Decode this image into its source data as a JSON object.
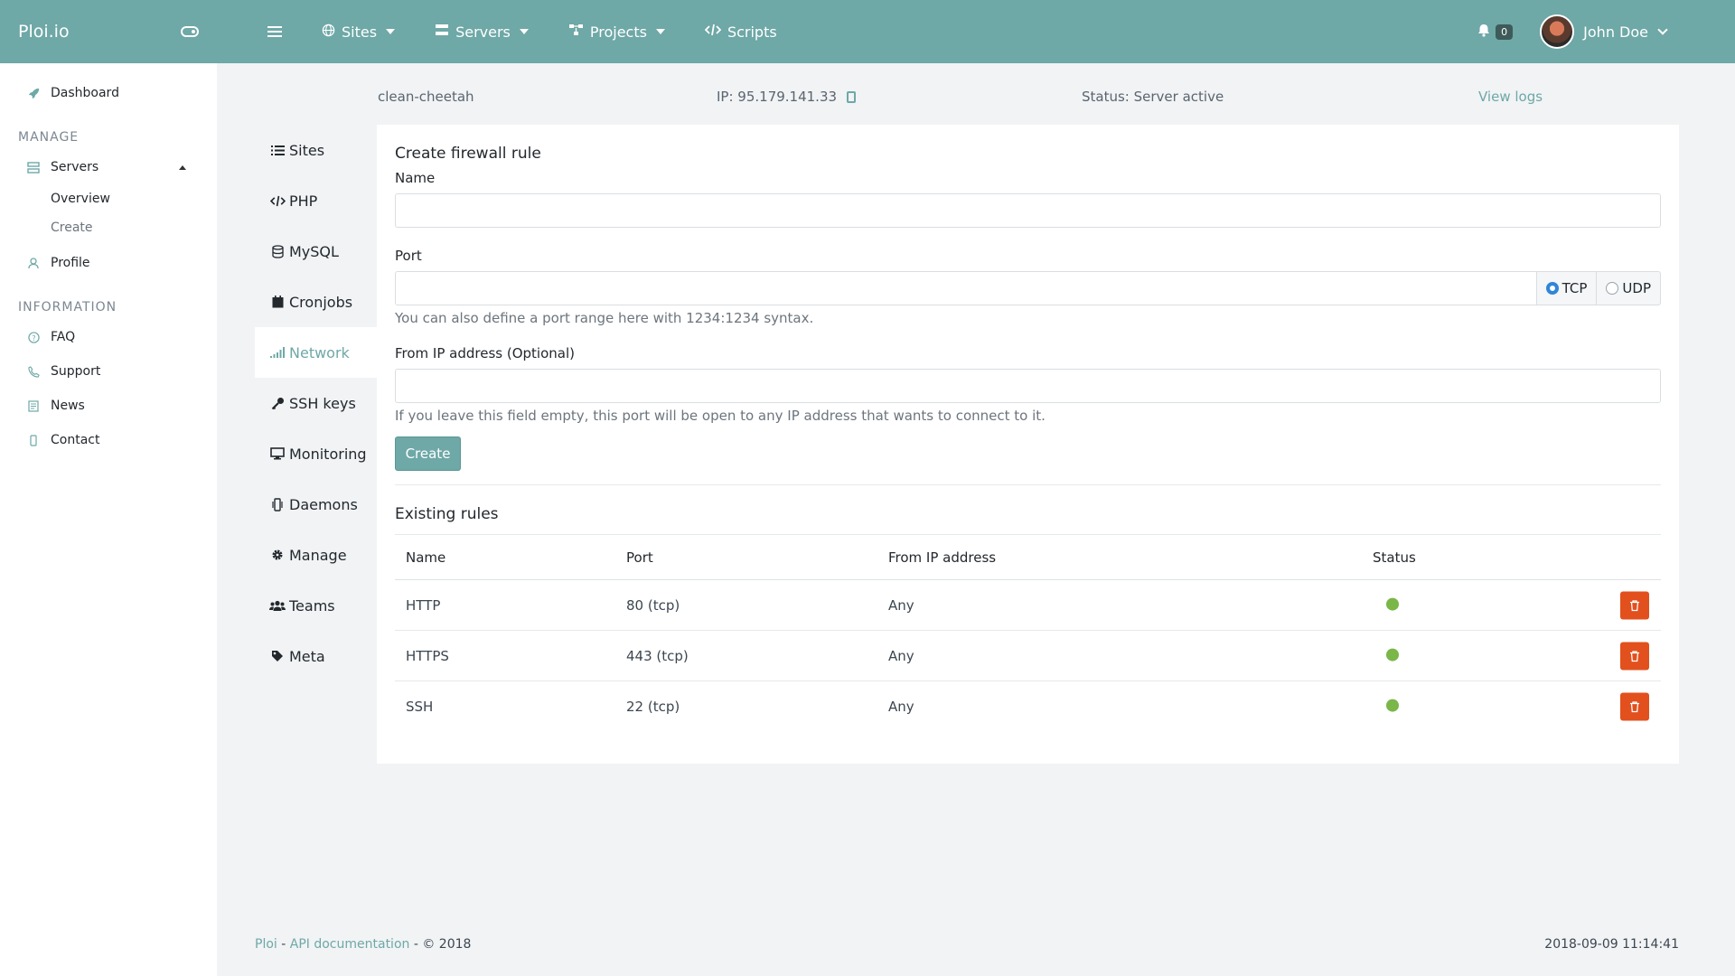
{
  "brand": "Ploi.io",
  "sidebar": {
    "dashboard": "Dashboard",
    "manage_heading": "MANAGE",
    "servers": "Servers",
    "overview": "Overview",
    "create": "Create",
    "profile": "Profile",
    "info_heading": "INFORMATION",
    "faq": "FAQ",
    "support": "Support",
    "news": "News",
    "contact": "Contact"
  },
  "topbar": {
    "sites": "Sites",
    "servers": "Servers",
    "projects": "Projects",
    "scripts": "Scripts",
    "notifications": "0",
    "user": "John Doe"
  },
  "server": {
    "name": "clean-cheetah",
    "ip": "IP: 95.179.141.33",
    "status": "Status: Server active",
    "view_logs": "View logs"
  },
  "subnav": [
    "Sites",
    "PHP",
    "MySQL",
    "Cronjobs",
    "Network",
    "SSH keys",
    "Monitoring",
    "Daemons",
    "Manage",
    "Teams",
    "Meta"
  ],
  "form": {
    "title": "Create firewall rule",
    "name_label": "Name",
    "port_label": "Port",
    "tcp": "TCP",
    "udp": "UDP",
    "port_help": "You can also define a port range here with 1234:1234 syntax.",
    "ip_label": "From IP address (Optional)",
    "ip_help": "If you leave this field empty, this port will be open to any IP address that wants to connect to it.",
    "create_button": "Create"
  },
  "rules": {
    "title": "Existing rules",
    "columns": [
      "Name",
      "Port",
      "From IP address",
      "Status"
    ],
    "rows": [
      {
        "name": "HTTP",
        "port": "80 (tcp)",
        "ip": "Any"
      },
      {
        "name": "HTTPS",
        "port": "443 (tcp)",
        "ip": "Any"
      },
      {
        "name": "SSH",
        "port": "22 (tcp)",
        "ip": "Any"
      }
    ]
  },
  "footer": {
    "ploi": "Ploi",
    "sep1": " - ",
    "api": "API documentation",
    "copy": " - © 2018",
    "timestamp": "2018-09-09 11:14:41"
  },
  "colors": {
    "accent": "#6ea8a7",
    "danger": "#e2501e",
    "active": "#7ab648"
  }
}
